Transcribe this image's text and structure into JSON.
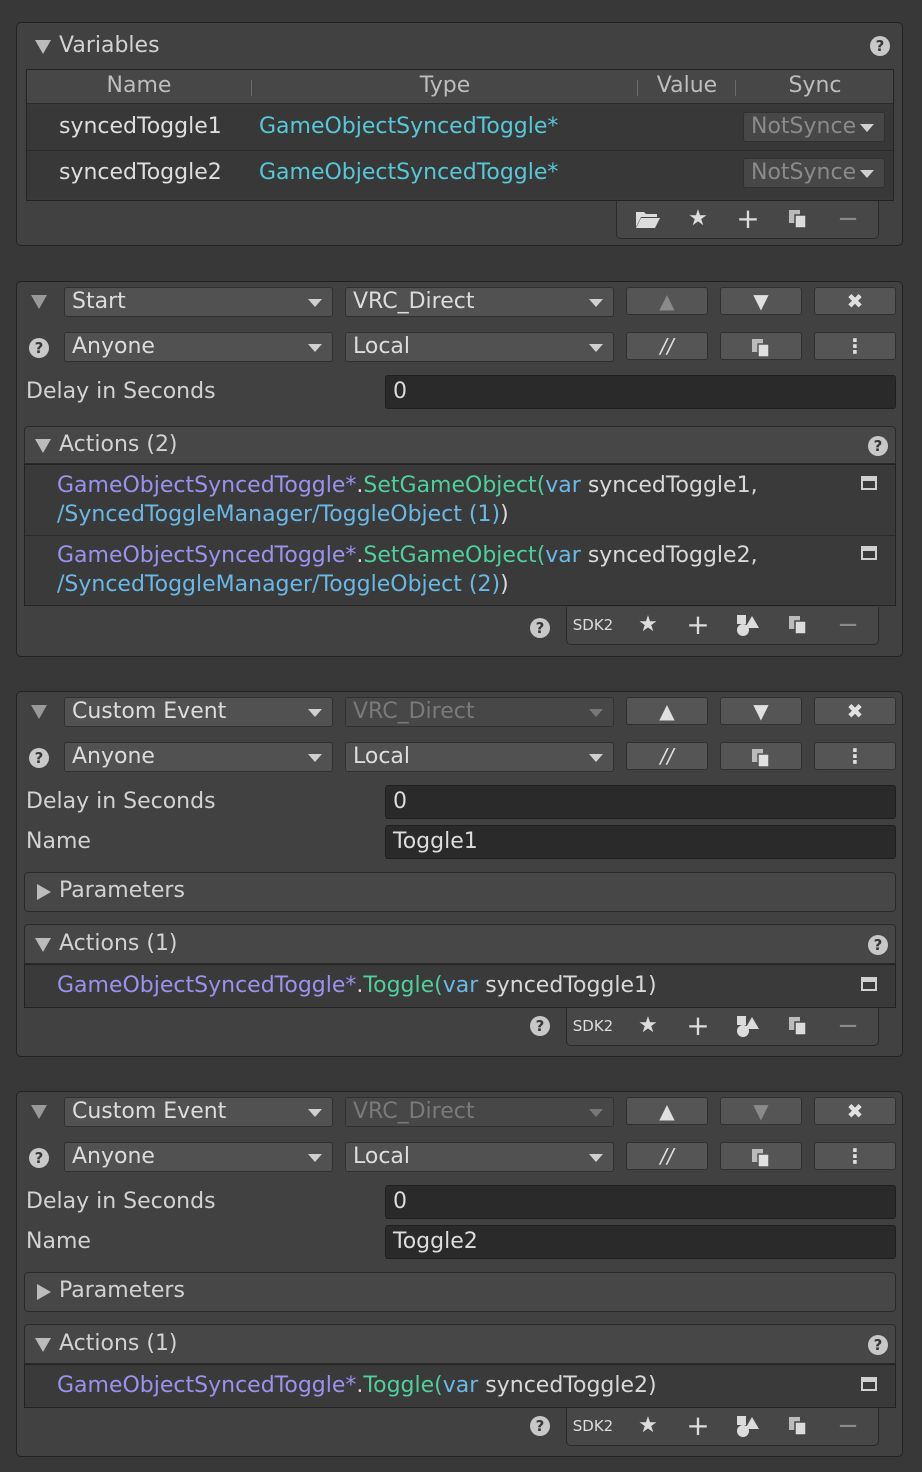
{
  "variables": {
    "title": "Variables",
    "columns": [
      "Name",
      "Type",
      "Value",
      "Sync"
    ],
    "rows": [
      {
        "name": "syncedToggle1",
        "type": "GameObjectSyncedToggle*",
        "sync": "NotSynce"
      },
      {
        "name": "syncedToggle2",
        "type": "GameObjectSyncedToggle*",
        "sync": "NotSynce"
      }
    ]
  },
  "events": [
    {
      "event_type": "Start",
      "broadcast": "VRC_Direct",
      "access": "Anyone",
      "scope": "Local",
      "delay_label": "Delay in Seconds",
      "delay_value": "0",
      "actions_title": "Actions (2)",
      "actions": [
        {
          "cls": "GameObjectSyncedToggle*",
          "dot": ".",
          "method": "SetGameObject",
          "open": "(",
          "kw": "var",
          "arg": " syncedToggle1,",
          "line2": "/SyncedToggleManager/ToggleObject (1)",
          "close": ")"
        },
        {
          "cls": "GameObjectSyncedToggle*",
          "dot": ".",
          "method": "SetGameObject",
          "open": "(",
          "kw": "var",
          "arg": " syncedToggle2,",
          "line2": "/SyncedToggleManager/ToggleObject (2)",
          "close": ")"
        }
      ],
      "sdk": "SDK2"
    },
    {
      "event_type": "Custom Event",
      "broadcast": "VRC_Direct",
      "access": "Anyone",
      "scope": "Local",
      "delay_label": "Delay in Seconds",
      "delay_value": "0",
      "name_label": "Name",
      "name_value": "Toggle1",
      "params_title": "Parameters",
      "actions_title": "Actions (1)",
      "actions": [
        {
          "cls": "GameObjectSyncedToggle*",
          "dot": ".",
          "method": "Toggle",
          "open": "(",
          "kw": "var",
          "arg": " syncedToggle1",
          "close": ")"
        }
      ],
      "sdk": "SDK2"
    },
    {
      "event_type": "Custom Event",
      "broadcast": "VRC_Direct",
      "access": "Anyone",
      "scope": "Local",
      "delay_label": "Delay in Seconds",
      "delay_value": "0",
      "name_label": "Name",
      "name_value": "Toggle2",
      "params_title": "Parameters",
      "actions_title": "Actions (1)",
      "actions": [
        {
          "cls": "GameObjectSyncedToggle*",
          "dot": ".",
          "method": "Toggle",
          "open": "(",
          "kw": "var",
          "arg": " syncedToggle2",
          "close": ")"
        }
      ],
      "sdk": "SDK2"
    }
  ],
  "buttons": {
    "up": "▲",
    "down": "▼",
    "remove": "✖",
    "comment": "//",
    "more": "⋮",
    "add": "+",
    "minus": "−",
    "star": "★",
    "help": "?"
  },
  "colors": {
    "background": "#383838",
    "class_name": "#9a92ee",
    "method_name": "#4ecf9c",
    "keyword": "#6ab8e6",
    "type_name": "#56c8d8"
  },
  "icons": [
    "collapse-triangle-icon",
    "help-icon",
    "folder-open-icon",
    "star-icon",
    "plus-icon",
    "copy-icon",
    "minus-icon",
    "shapes-icon",
    "window-icon",
    "dropdown-arrow-icon",
    "more-vert-icon"
  ]
}
